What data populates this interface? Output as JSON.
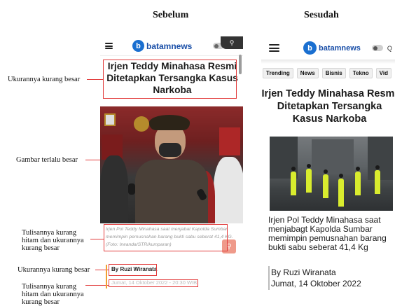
{
  "columns": {
    "before": "Sebelum",
    "after": "Sesudah"
  },
  "annotations": {
    "title_size": "Ukurannya kurang besar",
    "image_size": "Gambar terlalu besar",
    "caption_issue": [
      "Tulisannya kurang",
      "hitam dan ukurannya",
      "kurang besar"
    ],
    "author_size": "Ukurannya kurang besar",
    "date_issue": [
      "Tulisannya kurang",
      "hitam dan ukurannya",
      "kurang besar"
    ]
  },
  "before": {
    "brand": "batamnews",
    "logo_letter": "b",
    "headline": "Irjen Teddy Minahasa Resmi Ditetapkan Tersangka Kasus Narkoba",
    "caption": "Irjen Pol Teddy Minahasa saat menjabat Kapolda Sumbar memimpin pemusnahan barang bukti sabu seberat 41,4 KG. (Foto: Irwanda/STR/kumparan)",
    "author": "By Ruzi Wiranata",
    "date": "Jumat, 14 Oktober 2022 - 20:30 WIB"
  },
  "after": {
    "brand": "batamnews",
    "logo_letter": "b",
    "chips": [
      "Trending",
      "News",
      "Bisnis",
      "Tekno",
      "Vid"
    ],
    "headline": "Irjen Teddy Minahasa Resmi Ditetapkan Tersangka Kasus Narkoba",
    "caption": "Irjen Pol Teddy Minahasa saat menjabagt Kapolda Sumbar memimpin pemusnahan barang bukti sabu seberat 41,4 Kg",
    "author": "By Ruzi Wiranata",
    "date": "Jumat, 14 Oktober 2022"
  },
  "colors": {
    "annotation_red": "#e23b3b",
    "brand_blue": "#1a4fa8",
    "caption_gray": "#9a9a9a",
    "date_gray": "#bdbdbd"
  },
  "icons": [
    "hamburger-icon",
    "batamnews-logo-icon",
    "theme-toggle-icon",
    "search-icon",
    "zoom-icon"
  ]
}
